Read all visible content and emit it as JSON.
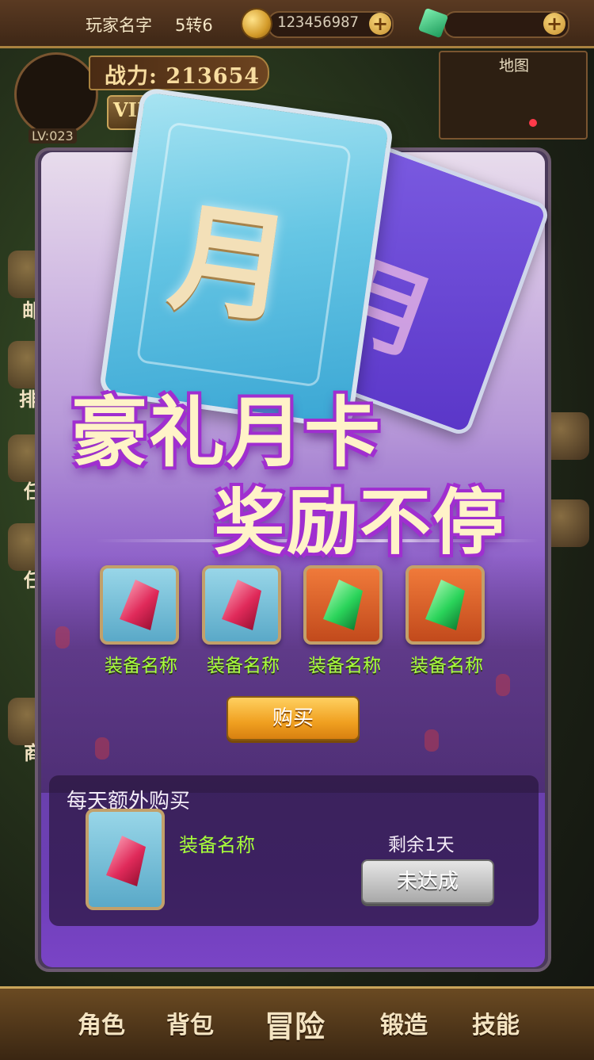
{
  "hud": {
    "player_name": "玩家名字",
    "rebirth": "5转6",
    "coins": "123456987",
    "plus": "+",
    "power": "战力: 213654",
    "vip": "VIP",
    "level": "LV:023",
    "map_label": "地图"
  },
  "side_menu": [
    {
      "label": "邮"
    },
    {
      "label": "排"
    },
    {
      "label": "任"
    },
    {
      "label": "任"
    },
    {
      "label": "商"
    }
  ],
  "popup": {
    "card_glyph": "月",
    "title_line1": "豪礼月卡",
    "title_line2": "奖励不停",
    "rewards": [
      {
        "label": "装备名称",
        "gem": "red-crystal",
        "frame": "blue"
      },
      {
        "label": "装备名称",
        "gem": "red-crystal",
        "frame": "blue"
      },
      {
        "label": "装备名称",
        "gem": "green-crystal",
        "frame": "orange"
      },
      {
        "label": "装备名称",
        "gem": "green-crystal",
        "frame": "orange"
      }
    ],
    "buy_label": "购买",
    "daily": {
      "title": "每天额外购买",
      "item_name": "装备名称",
      "remaining": "剩余1天",
      "status_button": "未达成"
    }
  },
  "bottom_nav": [
    {
      "label": "角色"
    },
    {
      "label": "背包"
    },
    {
      "label": "冒险"
    },
    {
      "label": "锻造"
    },
    {
      "label": "技能"
    }
  ],
  "colors": {
    "reward_label": "#a8ff3a",
    "title_outline": "#a02ed0",
    "buy_button": "#f0a020"
  }
}
